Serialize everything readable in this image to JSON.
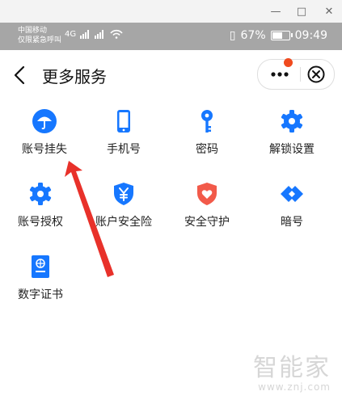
{
  "window": {
    "minimize": "—",
    "maximize": "□",
    "close": "✕"
  },
  "status_bar": {
    "carrier_line1": "中国移动",
    "carrier_line2": "仅限紧急呼叫",
    "signal_text": "4G",
    "battery_percent": "67%",
    "battery_level": 0.67,
    "time": "09:49"
  },
  "nav": {
    "title": "更多服务",
    "back_icon": "chevron-left-icon",
    "more_icon": "ellipsis-icon",
    "close_icon": "circle-close-icon"
  },
  "services": [
    {
      "label": "账号挂失",
      "icon": "umbrella-icon"
    },
    {
      "label": "手机号",
      "icon": "mobile-phone-icon"
    },
    {
      "label": "密码",
      "icon": "key-icon"
    },
    {
      "label": "解锁设置",
      "icon": "gear-icon"
    },
    {
      "label": "账号授权",
      "icon": "gear-icon"
    },
    {
      "label": "账户安全险",
      "icon": "yuan-shield-icon"
    },
    {
      "label": "安全守护",
      "icon": "heart-shield-icon"
    },
    {
      "label": "暗号",
      "icon": "link-diamond-icon"
    },
    {
      "label": "数字证书",
      "icon": "certificate-book-icon"
    }
  ],
  "colors": {
    "accent_blue": "#1677ff",
    "guard_red": "#f25a4a",
    "annotation_red": "#e8312a",
    "dot_red": "#f04a1e"
  },
  "watermark": {
    "text": "智能家",
    "url": "www.znj.com"
  }
}
